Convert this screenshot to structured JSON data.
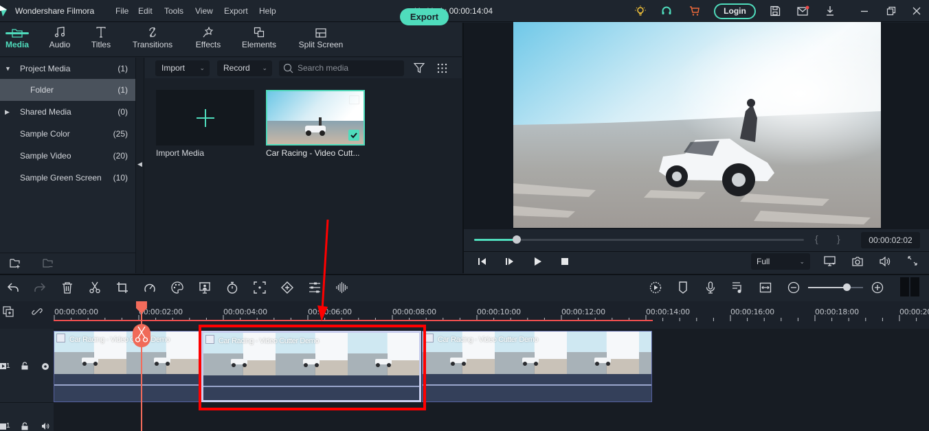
{
  "app": {
    "name": "Wondershare Filmora",
    "document_title": "Untitled : 00:00:14:04",
    "menu": [
      "File",
      "Edit",
      "Tools",
      "View",
      "Export",
      "Help"
    ],
    "title_icons": [
      "lightbulb-icon",
      "headset-icon",
      "cart-icon",
      "save-icon",
      "mail-icon",
      "download-icon",
      "minimize-icon",
      "restore-icon",
      "close-icon"
    ],
    "login_label": "Login",
    "accent_color": "#4fdcbc"
  },
  "nav": {
    "tabs": [
      {
        "label": "Media",
        "icon": "folder-icon",
        "active": true
      },
      {
        "label": "Audio",
        "icon": "music-note-icon",
        "active": false
      },
      {
        "label": "Titles",
        "icon": "text-icon",
        "active": false
      },
      {
        "label": "Transitions",
        "icon": "transitions-icon",
        "active": false
      },
      {
        "label": "Effects",
        "icon": "effects-icon",
        "active": false
      },
      {
        "label": "Elements",
        "icon": "elements-icon",
        "active": false
      },
      {
        "label": "Split Screen",
        "icon": "split-screen-icon",
        "active": false
      }
    ],
    "export_label": "Export"
  },
  "sidebar": {
    "items": [
      {
        "label": "Project Media",
        "count": "(1)",
        "expand": "down"
      },
      {
        "label": "Folder",
        "count": "(1)",
        "selected": true
      },
      {
        "label": "Shared Media",
        "count": "(0)",
        "expand": "right"
      },
      {
        "label": "Sample Color",
        "count": "(25)"
      },
      {
        "label": "Sample Video",
        "count": "(20)"
      },
      {
        "label": "Sample Green Screen",
        "count": "(10)"
      }
    ]
  },
  "media": {
    "import_label": "Import",
    "record_label": "Record",
    "search_placeholder": "Search media",
    "import_tile_label": "Import Media",
    "clip_label": "Car Racing - Video Cutt..."
  },
  "preview": {
    "timecode": "00:00:02:02",
    "progress": 0.13,
    "mark_in": "{",
    "mark_out": "}",
    "quality": "Full"
  },
  "timeline": {
    "zoom_level": 0.7,
    "ruler_labels": [
      "00:00:00:00",
      "00:00:02:00",
      "00:00:04:00",
      "00:00:06:00",
      "00:00:08:00",
      "00:00:10:00",
      "00:00:12:00",
      "00:00:14:00",
      "00:00:16:00",
      "00:00:18:00",
      "00:00:20"
    ],
    "playhead_time": "00:00:02:02",
    "video_track_label": "1",
    "audio_track_label": "1",
    "clips": [
      {
        "title": "Car Racing - Video Cutter Demo"
      },
      {
        "title": "Car Racing - Video Cutter Demo",
        "selected": true
      },
      {
        "title": "Car Racing - Video Cutter Demo"
      }
    ]
  }
}
